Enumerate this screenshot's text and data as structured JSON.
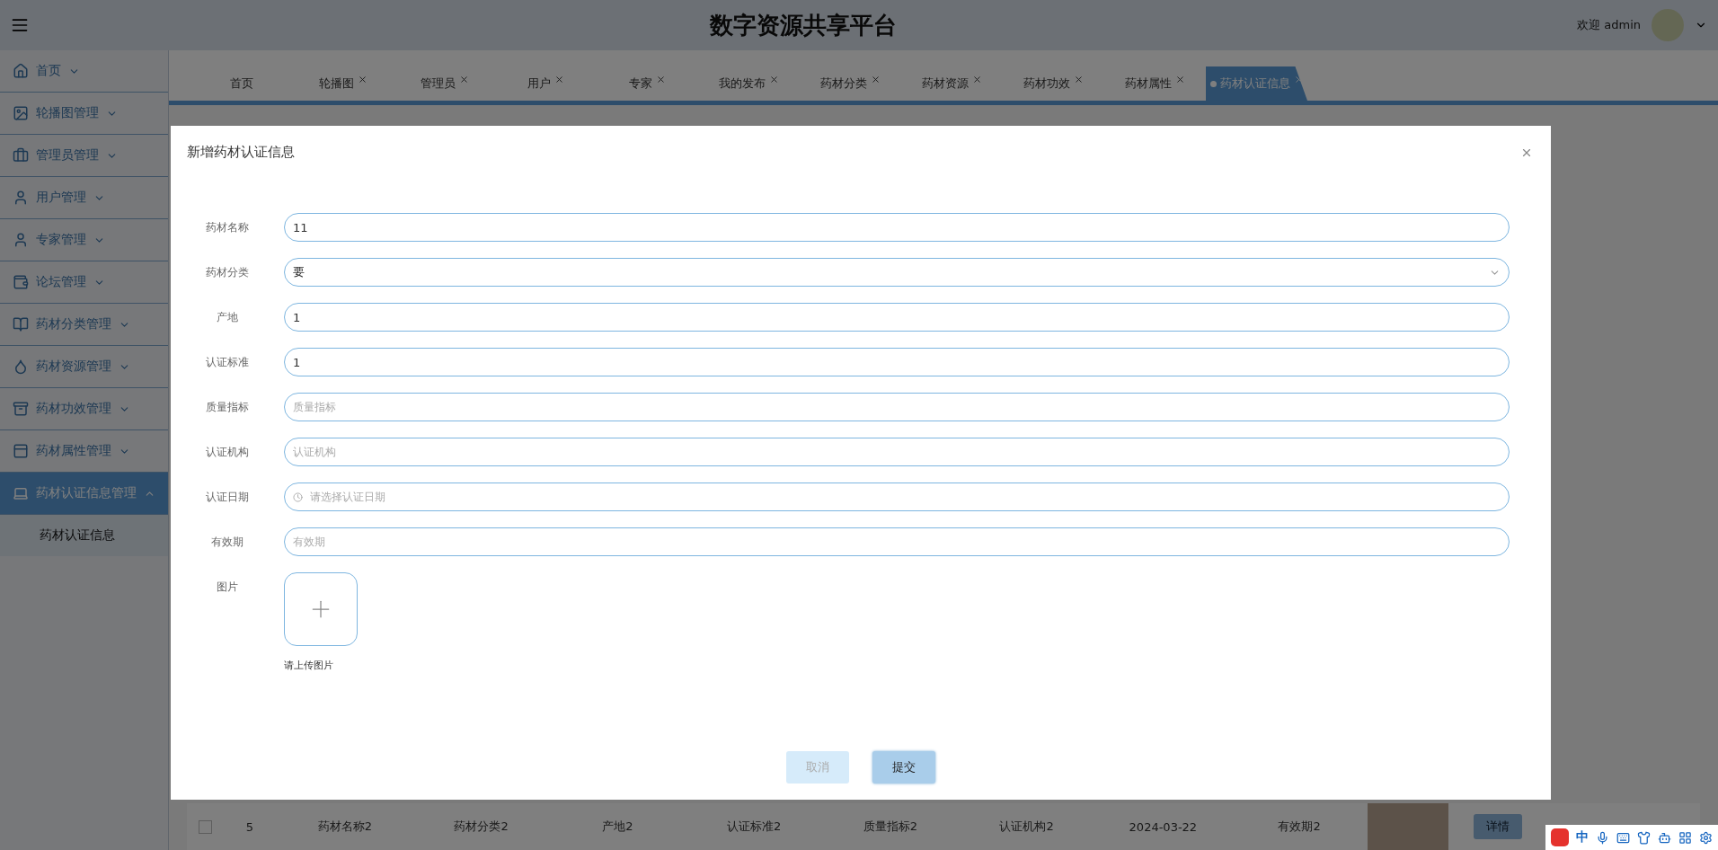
{
  "header": {
    "title": "数字资源共享平台",
    "welcome": "欢迎 admin"
  },
  "sidebar": {
    "items": [
      {
        "label": "首页",
        "expanded": false,
        "selected": false
      },
      {
        "label": "轮播图管理",
        "expanded": false,
        "selected": false
      },
      {
        "label": "管理员管理",
        "expanded": false,
        "selected": false
      },
      {
        "label": "用户管理",
        "expanded": false,
        "selected": false
      },
      {
        "label": "专家管理",
        "expanded": false,
        "selected": false
      },
      {
        "label": "论坛管理",
        "expanded": false,
        "selected": false
      },
      {
        "label": "药材分类管理",
        "expanded": false,
        "selected": false
      },
      {
        "label": "药材资源管理",
        "expanded": false,
        "selected": false
      },
      {
        "label": "药材功效管理",
        "expanded": false,
        "selected": false
      },
      {
        "label": "药材属性管理",
        "expanded": false,
        "selected": false
      },
      {
        "label": "药材认证信息管理",
        "expanded": true,
        "selected": true,
        "children": [
          {
            "label": "药材认证信息",
            "selected": false
          }
        ]
      }
    ]
  },
  "tabs": [
    {
      "label": "首页",
      "closable": false,
      "selected": false
    },
    {
      "label": "轮播图",
      "closable": true,
      "selected": false
    },
    {
      "label": "管理员",
      "closable": true,
      "selected": false
    },
    {
      "label": "用户",
      "closable": true,
      "selected": false
    },
    {
      "label": "专家",
      "closable": true,
      "selected": false
    },
    {
      "label": "我的发布",
      "closable": true,
      "selected": false
    },
    {
      "label": "药材分类",
      "closable": true,
      "selected": false
    },
    {
      "label": "药材资源",
      "closable": true,
      "selected": false
    },
    {
      "label": "药材功效",
      "closable": true,
      "selected": false
    },
    {
      "label": "药材属性",
      "closable": true,
      "selected": false
    },
    {
      "label": "药材认证信息",
      "closable": true,
      "selected": true
    }
  ],
  "table_row": {
    "checked": false,
    "cells": [
      "5",
      "药材名称2",
      "药材分类2",
      "产地2",
      "认证标准2",
      "质量指标2",
      "认证机构2",
      "2024-03-22",
      "有效期2"
    ],
    "button": "详情"
  },
  "dialog": {
    "title": "新增药材认证信息",
    "fields": [
      {
        "kind": "text",
        "label": "药材名称",
        "value": "11"
      },
      {
        "kind": "select",
        "label": "药材分类",
        "value": "要"
      },
      {
        "kind": "text",
        "label": "产地",
        "value": "1"
      },
      {
        "kind": "text",
        "label": "认证标准",
        "value": "1"
      },
      {
        "kind": "text",
        "label": "质量指标",
        "placeholder": "质量指标"
      },
      {
        "kind": "text",
        "label": "认证机构",
        "placeholder": "认证机构"
      },
      {
        "kind": "date",
        "label": "认证日期",
        "placeholder": "请选择认证日期"
      },
      {
        "kind": "text",
        "label": "有效期",
        "placeholder": "有效期"
      },
      {
        "kind": "upload",
        "label": "图片",
        "hint": "请上传图片"
      }
    ],
    "buttons": [
      {
        "label": "取消",
        "disabled": true
      },
      {
        "label": "提交",
        "disabled": false
      }
    ]
  },
  "ime_toolbar": {
    "mode": "中"
  }
}
